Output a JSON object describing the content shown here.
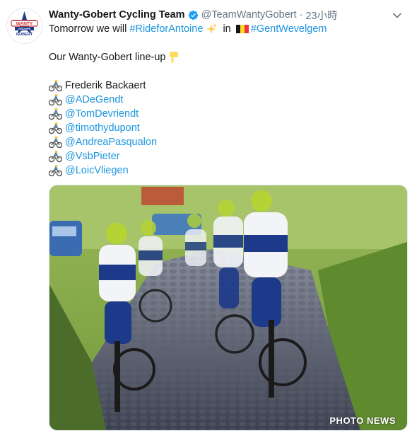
{
  "tweet": {
    "display_name": "Wanty-Gobert Cycling Team",
    "handle": "@TeamWantyGobert",
    "separator": "·",
    "timestamp": "23小時",
    "line1": {
      "text_start": "Tomorrow we will ",
      "hashtag1": "#RideforAntoine",
      "text_in": " in ",
      "hashtag2": "#GentWevelgem"
    },
    "line2": "Our Wanty-Gobert line-up",
    "lineup": [
      {
        "text": "Frederik Backaert",
        "is_mention": false
      },
      {
        "text": "@ADeGendt",
        "is_mention": true
      },
      {
        "text": "@TomDevriendt",
        "is_mention": true
      },
      {
        "text": "@timothydupont",
        "is_mention": true
      },
      {
        "text": "@AndreaPasqualon",
        "is_mention": true
      },
      {
        "text": "@VsbPieter",
        "is_mention": true
      },
      {
        "text": "@LoicVliegen",
        "is_mention": true
      }
    ],
    "media_watermark": "PHOTO NEWS",
    "avatar_logo": {
      "top": "WANTY",
      "mid": "GROUPE",
      "bottom": "GOBERT"
    }
  },
  "icons": {
    "verified": "verified-badge-icon",
    "caret": "chevron-down-icon",
    "sparkles": "sparkles-emoji",
    "flag": "belgium-flag-emoji",
    "pointing": "pointing-down-emoji",
    "bike": "cyclist-emoji"
  },
  "colors": {
    "link": "#1b95e0",
    "muted": "#657786",
    "text": "#14171a",
    "team_green": "#b5d334",
    "team_blue": "#1d3a8a"
  }
}
